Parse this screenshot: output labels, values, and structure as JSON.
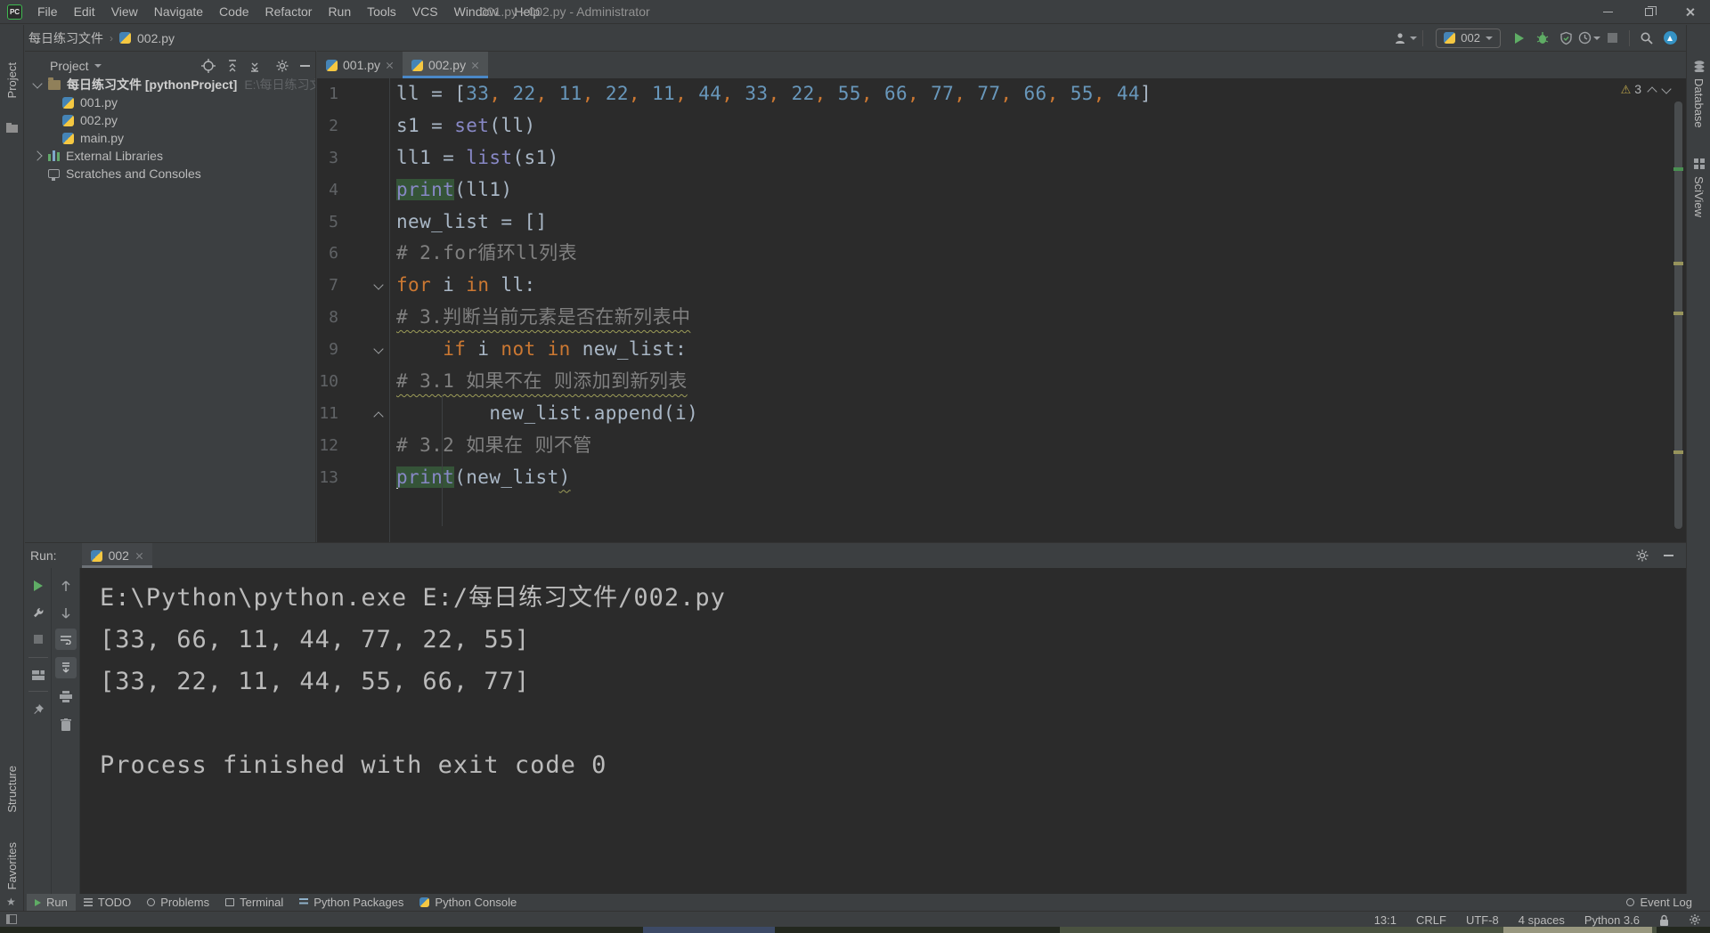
{
  "title_bar": {
    "logo": "PC",
    "menu": [
      "File",
      "Edit",
      "View",
      "Navigate",
      "Code",
      "Refactor",
      "Run",
      "Tools",
      "VCS",
      "Window",
      "Help"
    ],
    "title": "001.py - 002.py - Administrator"
  },
  "toolbar": {
    "breadcrumb": {
      "items": [
        "每日练习文件",
        "002.py"
      ],
      "separator": "›"
    },
    "run_config": "002"
  },
  "left_strip": {
    "top": "Project",
    "bottom": [
      "Structure",
      "Favorites"
    ]
  },
  "right_strip": [
    "Database",
    "SciView"
  ],
  "project_panel": {
    "header": "Project",
    "tree": [
      {
        "label": "每日练习文件 [pythonProject]",
        "path": "E:\\每日练习文件",
        "icon": "folder",
        "chevron": "down",
        "bold": true,
        "level": 0
      },
      {
        "label": "001.py",
        "icon": "python",
        "level": 1
      },
      {
        "label": "002.py",
        "icon": "python",
        "level": 1
      },
      {
        "label": "main.py",
        "icon": "python",
        "level": 1
      },
      {
        "label": "External Libraries",
        "icon": "library",
        "chevron": "right",
        "level": 0
      },
      {
        "label": "Scratches and Consoles",
        "icon": "scratch",
        "level": 0
      }
    ]
  },
  "editor": {
    "tabs": [
      {
        "label": "001.py",
        "active": false
      },
      {
        "label": "002.py",
        "active": true
      }
    ],
    "warning_count": "3",
    "lines": [
      {
        "n": "1",
        "fold": null,
        "tokens": [
          [
            "d",
            "ll = ["
          ],
          [
            "n",
            "33"
          ],
          [
            "o",
            ", "
          ],
          [
            "n",
            "22"
          ],
          [
            "o",
            ", "
          ],
          [
            "n",
            "11"
          ],
          [
            "o",
            ", "
          ],
          [
            "n",
            "22"
          ],
          [
            "o",
            ", "
          ],
          [
            "n",
            "11"
          ],
          [
            "o",
            ", "
          ],
          [
            "n",
            "44"
          ],
          [
            "o",
            ", "
          ],
          [
            "n",
            "33"
          ],
          [
            "o",
            ", "
          ],
          [
            "n",
            "22"
          ],
          [
            "o",
            ", "
          ],
          [
            "n",
            "55"
          ],
          [
            "o",
            ", "
          ],
          [
            "n",
            "66"
          ],
          [
            "o",
            ", "
          ],
          [
            "n",
            "77"
          ],
          [
            "o",
            ", "
          ],
          [
            "n",
            "77"
          ],
          [
            "o",
            ", "
          ],
          [
            "n",
            "66"
          ],
          [
            "o",
            ", "
          ],
          [
            "n",
            "55"
          ],
          [
            "o",
            ", "
          ],
          [
            "n",
            "44"
          ],
          [
            "d",
            "]"
          ]
        ]
      },
      {
        "n": "2",
        "fold": null,
        "tokens": [
          [
            "d",
            "s1 = "
          ],
          [
            "b",
            "set"
          ],
          [
            "d",
            "(ll)"
          ]
        ]
      },
      {
        "n": "3",
        "fold": null,
        "tokens": [
          [
            "d",
            "ll1 = "
          ],
          [
            "b",
            "list"
          ],
          [
            "d",
            "(s1)"
          ]
        ]
      },
      {
        "n": "4",
        "fold": null,
        "tokens": [
          [
            "bh",
            "print"
          ],
          [
            "d",
            "(ll1)"
          ]
        ]
      },
      {
        "n": "5",
        "fold": null,
        "tokens": [
          [
            "d",
            "new_list = []"
          ]
        ]
      },
      {
        "n": "6",
        "fold": null,
        "tokens": [
          [
            "c",
            "# 2.for循环ll列表"
          ]
        ]
      },
      {
        "n": "7",
        "fold": "down",
        "tokens": [
          [
            "k",
            "for"
          ],
          [
            "d",
            " i "
          ],
          [
            "k",
            "in"
          ],
          [
            "d",
            " ll:"
          ]
        ]
      },
      {
        "n": "8",
        "fold": null,
        "tokens": [
          [
            "ct",
            "# 3.判断当前元素是否在新列表中"
          ]
        ]
      },
      {
        "n": "9",
        "fold": "down",
        "tokens": [
          [
            "d",
            "    "
          ],
          [
            "k",
            "if"
          ],
          [
            "d",
            " i "
          ],
          [
            "k",
            "not"
          ],
          [
            "d",
            " "
          ],
          [
            "k",
            "in"
          ],
          [
            "d",
            " new_list:"
          ]
        ]
      },
      {
        "n": "10",
        "fold": null,
        "tokens": [
          [
            "ct",
            "# 3.1 如果不在 则添加到新列表"
          ]
        ]
      },
      {
        "n": "11",
        "fold": "up",
        "tokens": [
          [
            "d",
            "        new_list.append(i)"
          ]
        ]
      },
      {
        "n": "12",
        "fold": null,
        "tokens": [
          [
            "c",
            "# 3.2 如果在 则不管"
          ]
        ]
      },
      {
        "n": "13",
        "fold": null,
        "tokens": [
          [
            "caret",
            ""
          ],
          [
            "bh",
            "print"
          ],
          [
            "d",
            "(new_list"
          ],
          [
            "dt",
            ")"
          ]
        ]
      }
    ]
  },
  "run_panel": {
    "label": "Run:",
    "tab": "002",
    "console": [
      "E:\\Python\\python.exe E:/每日练习文件/002.py",
      "[33, 66, 11, 44, 77, 22, 55]",
      "[33, 22, 11, 44, 55, 66, 77]",
      "",
      "Process finished with exit code 0"
    ]
  },
  "bottom_bar": {
    "items": [
      {
        "label": "Run",
        "icon": "play",
        "active": true
      },
      {
        "label": "TODO",
        "icon": "list",
        "active": false
      },
      {
        "label": "Problems",
        "icon": "circle",
        "active": false
      },
      {
        "label": "Terminal",
        "icon": "box",
        "active": false
      },
      {
        "label": "Python Packages",
        "icon": "stack",
        "active": false
      },
      {
        "label": "Python Console",
        "icon": "python",
        "active": false
      }
    ],
    "event_log": "Event Log"
  },
  "status_bar": {
    "items": [
      "13:1",
      "CRLF",
      "UTF-8",
      "4 spaces",
      "Python 3.6"
    ]
  },
  "colors": {
    "panel": "#3c3f41",
    "editor_bg": "#2b2b2b",
    "border": "#323232",
    "text": "#bbbbbb",
    "keyword": "#cc7832",
    "number": "#6897bb",
    "builtin": "#8888c6",
    "comment": "#808080",
    "default_code": "#a9b7c6",
    "tab_underline": "#4a88c7",
    "occurrence_bg": "#355438",
    "run_green": "#5fad65"
  }
}
